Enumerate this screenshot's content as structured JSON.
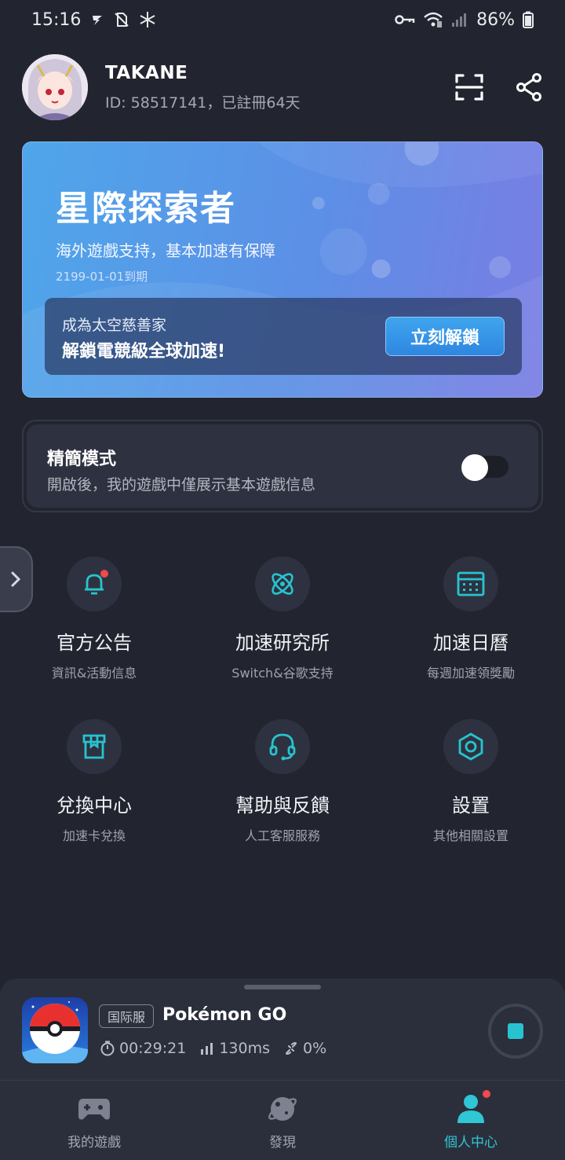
{
  "status_bar": {
    "time": "15:16",
    "battery": "86%"
  },
  "profile": {
    "username": "TAKANE",
    "id_text": "ID: 58517141，已註冊64天"
  },
  "vip": {
    "title": "星際探索者",
    "description": "海外遊戲支持，基本加速有保障",
    "expiry": "2199-01-01到期",
    "banner_line1": "成為太空慈善家",
    "banner_line2": "解鎖電競級全球加速!",
    "unlock_label": "立刻解鎖"
  },
  "simple_mode": {
    "title": "精簡模式",
    "description": "開啟後，我的遊戲中僅展示基本遊戲信息",
    "enabled": false
  },
  "features": [
    {
      "label": "官方公告",
      "sub": "資訊&活動信息",
      "icon": "bell-icon"
    },
    {
      "label": "加速研究所",
      "sub": "Switch&谷歌支持",
      "icon": "atom-icon"
    },
    {
      "label": "加速日曆",
      "sub": "每週加速領獎勵",
      "icon": "calendar-icon"
    },
    {
      "label": "兌換中心",
      "sub": "加速卡兌換",
      "icon": "gift-box-icon"
    },
    {
      "label": "幫助與反饋",
      "sub": "人工客服服務",
      "icon": "headset-icon"
    },
    {
      "label": "設置",
      "sub": "其他相關設置",
      "icon": "settings-hexagon-icon"
    }
  ],
  "now_playing": {
    "server_tag": "国际服",
    "game_title": "Pokémon GO",
    "duration": "00:29:21",
    "latency": "130ms",
    "packet_loss": "0%"
  },
  "nav": [
    {
      "label": "我的遊戲",
      "icon": "gamepad-icon",
      "active": false
    },
    {
      "label": "發現",
      "icon": "planet-icon",
      "active": false
    },
    {
      "label": "個人中心",
      "icon": "person-icon",
      "active": true
    }
  ],
  "colors": {
    "accent": "#2fc6d6",
    "background": "#22252f",
    "badge_red": "#f04a4a"
  }
}
